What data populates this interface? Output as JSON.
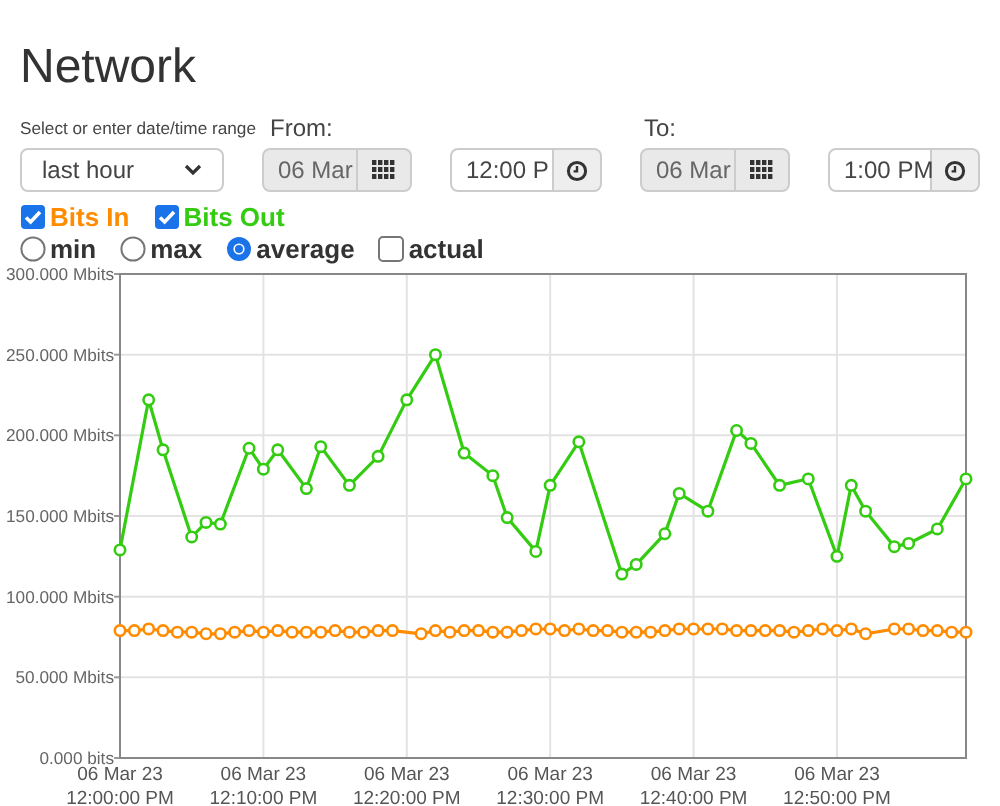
{
  "title": "Network",
  "range": {
    "label": "Select or enter date/time range",
    "value": "last hour"
  },
  "from": {
    "label": "From:",
    "date": "06 Mar",
    "time": "12:00 P"
  },
  "to": {
    "label": "To:",
    "date": "06 Mar",
    "time": "1:00 PM"
  },
  "legend": [
    {
      "checked": true
    },
    {
      "checked": true
    }
  ],
  "modes": [
    {
      "label": "min",
      "kind": "radio",
      "selected": false
    },
    {
      "label": "max",
      "kind": "radio",
      "selected": false
    },
    {
      "label": "average",
      "kind": "radio",
      "selected": true
    },
    {
      "label": "actual",
      "kind": "checkbox",
      "selected": false
    }
  ],
  "chart_data": {
    "type": "line",
    "ylim": [
      0,
      300
    ],
    "grid": true,
    "categories": [
      "06 Mar 23\n12:00:00 PM",
      null,
      null,
      null,
      null,
      null,
      null,
      null,
      null,
      null,
      "06 Mar 23\n12:10:00 PM",
      null,
      null,
      null,
      null,
      null,
      null,
      null,
      null,
      null,
      "06 Mar 23\n12:20:00 PM",
      null,
      null,
      null,
      null,
      null,
      null,
      null,
      null,
      null,
      "06 Mar 23\n12:30:00 PM",
      null,
      null,
      null,
      null,
      null,
      null,
      null,
      null,
      null,
      "06 Mar 23\n12:40:00 PM",
      null,
      null,
      null,
      null,
      null,
      null,
      null,
      null,
      null,
      "06 Mar 23\n12:50:00 PM",
      null,
      null,
      null,
      null,
      null,
      null,
      null,
      null,
      null
    ],
    "series": [
      {
        "name": "Bits In",
        "color": "#ff8c00",
        "marker": true,
        "values": [
          79,
          79,
          80,
          79,
          78,
          78,
          77,
          77,
          78,
          79,
          78,
          79,
          78,
          78,
          78,
          79,
          78,
          78,
          79,
          79,
          null,
          77,
          79,
          78,
          79,
          79,
          78,
          78,
          79,
          80,
          80,
          79,
          80,
          79,
          79,
          78,
          78,
          78,
          79,
          80,
          80,
          80,
          80,
          79,
          79,
          79,
          79,
          78,
          79,
          80,
          79,
          80,
          77,
          null,
          80,
          80,
          79,
          79,
          78,
          78
        ]
      },
      {
        "name": "Bits Out",
        "color": "#33cc11",
        "marker": true,
        "values": [
          129,
          null,
          222,
          191,
          null,
          137,
          146,
          145,
          null,
          192,
          179,
          191,
          null,
          167,
          193,
          null,
          169,
          null,
          187,
          null,
          222,
          null,
          250,
          null,
          189,
          null,
          175,
          149,
          null,
          128,
          169,
          null,
          196,
          null,
          null,
          114,
          120,
          null,
          139,
          164,
          null,
          153,
          null,
          203,
          195,
          null,
          169,
          null,
          173,
          null,
          125,
          169,
          153,
          null,
          131,
          133,
          null,
          142,
          null,
          173
        ]
      }
    ],
    "yticks": [
      {
        "value": 0,
        "label": "0.000 bits"
      },
      {
        "value": 50,
        "label": "50.000 Mbits"
      },
      {
        "value": 100,
        "label": "100.000 Mbits"
      },
      {
        "value": 150,
        "label": "150.000 Mbits"
      },
      {
        "value": 200,
        "label": "200.000 Mbits"
      },
      {
        "value": 250,
        "label": "250.000 Mbits"
      },
      {
        "value": 300,
        "label": "300.000 Mbits"
      }
    ]
  }
}
